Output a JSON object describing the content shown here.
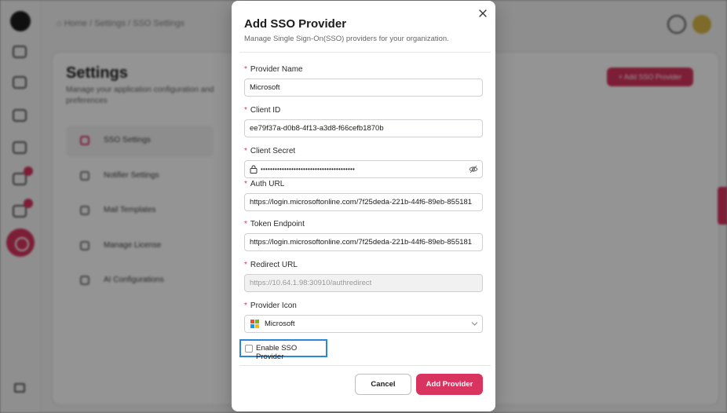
{
  "background": {
    "breadcrumb": "⌂ Home / Settings / SSO Settings",
    "settings_title": "Settings",
    "settings_subtitle": "Manage your application configuration and preferences",
    "menu_items": [
      "SSO Settings",
      "Notifier Settings",
      "Mail Templates",
      "Manage License",
      "AI Configurations"
    ],
    "add_button_label": "+ Add SSO Provider"
  },
  "modal": {
    "title": "Add SSO Provider",
    "description": "Manage Single Sign-On(SSO) providers for your organization.",
    "close_icon": "close-icon",
    "fields": {
      "provider_name": {
        "label": "Provider Name",
        "required_mark": "*",
        "value": "Microsoft"
      },
      "client_id": {
        "label": "Client ID",
        "required_mark": "*",
        "value": "ee79f37a-d0b8-4f13-a3d8-f66cefb1870b"
      },
      "client_secret": {
        "label": "Client Secret",
        "required_mark": "*",
        "value": "••••••••••••••••••••••••••••••••••••••••"
      },
      "auth_url": {
        "label": "Auth URL",
        "required_mark": "*",
        "value": "https://login.microsoftonline.com/7f25deda-221b-44f6-89eb-855181"
      },
      "token_endpoint": {
        "label": "Token Endpoint",
        "required_mark": "*",
        "value": "https://login.microsoftonline.com/7f25deda-221b-44f6-89eb-855181"
      },
      "redirect_url": {
        "label": "Redirect URL",
        "required_mark": "*",
        "value": "https://10.64.1.98:30910/authredirect"
      },
      "provider_icon": {
        "label": "Provider Icon",
        "required_mark": "*",
        "value": "Microsoft"
      }
    },
    "enable_checkbox_label": "Enable SSO Provider",
    "enable_checked": false,
    "cancel_label": "Cancel",
    "add_label": "Add Provider"
  },
  "colors": {
    "accent": "#d8345f",
    "focus_outline": "#2b88d8"
  }
}
